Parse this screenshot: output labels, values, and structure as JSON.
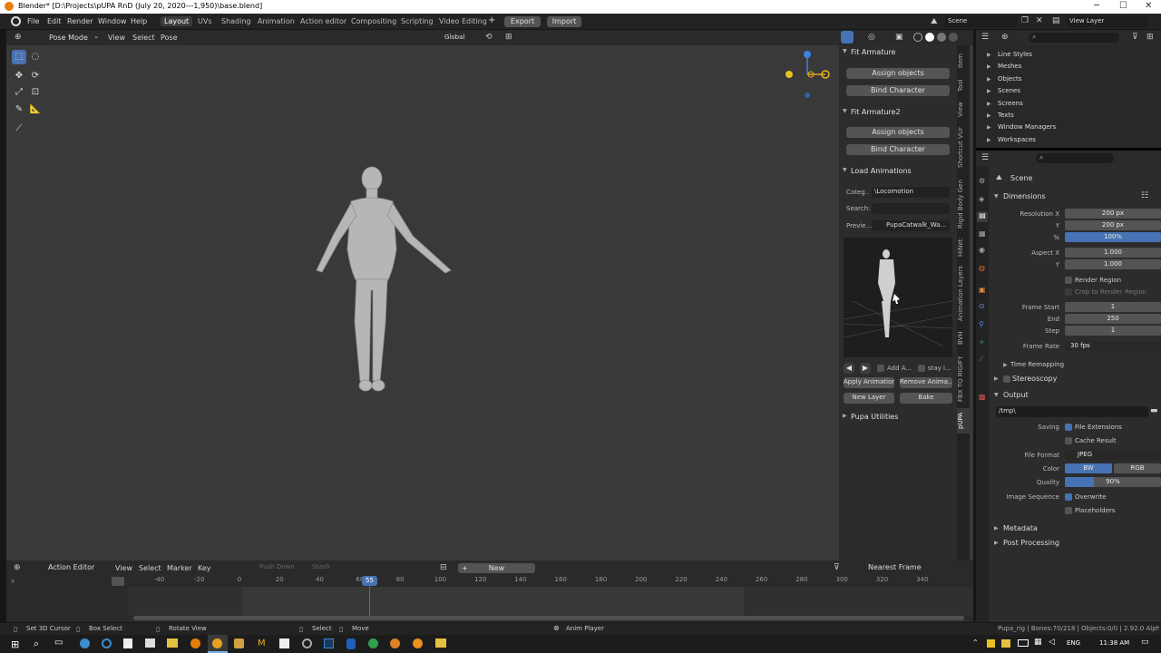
{
  "window": {
    "title": "Blender* [D:\\Projects\\pUPA RnD (July 20, 2020---1,950)\\base.blend]"
  },
  "menu": [
    "File",
    "Edit",
    "Render",
    "Window",
    "Help"
  ],
  "workspaces": [
    "Layout",
    "UVs",
    "Shading",
    "Animation",
    "Action editor",
    "Compositing",
    "Scripting",
    "Video Editing"
  ],
  "active_workspace": "Layout",
  "top_buttons": {
    "export": "Export",
    "import": "Import"
  },
  "scene_name": "Scene",
  "view_layer": "View Layer",
  "viewport_header": {
    "mode": "Pose Mode",
    "view": "View",
    "select": "Select",
    "pose": "Pose",
    "orientation": "Global"
  },
  "npanel": {
    "fit1": {
      "title": "Fit Armature",
      "assign": "Assign objects",
      "bind": "Bind Character"
    },
    "fit2": {
      "title": "Fit Armature2",
      "assign": "Assign objects",
      "bind": "Bind Character"
    },
    "load": {
      "title": "Load Animations",
      "category_label": "Categ..",
      "category_value": "\\Locomotion",
      "search_label": "Search:",
      "preview_label": "Previe...",
      "preview_value": "PupaCatwalk_Wa...",
      "add_label": "Add A...",
      "stay_label": "stay i...",
      "apply": "Apply Animation",
      "remove": "Remove Anima...",
      "new_layer": "New Layer",
      "bake": "Bake"
    },
    "utilities": "Pupa Utilities"
  },
  "sidebar_tabs": [
    "Item",
    "Tool",
    "View",
    "Shortcut VUr",
    "Rigid Body Gen",
    "HiNet",
    "Animation Layers",
    "BVH",
    "FBX TO RIGIFY",
    "pUPA"
  ],
  "outliner": {
    "items": [
      "Line Styles",
      "Meshes",
      "Objects",
      "Scenes",
      "Screens",
      "Texts",
      "Window Managers",
      "Workspaces"
    ]
  },
  "properties": {
    "scene": "Scene",
    "dimensions": "Dimensions",
    "resolution_x_label": "Resolution X",
    "resolution_x": "200 px",
    "y_label": "Y",
    "resolution_y": "200 px",
    "percent_label": "%",
    "percent": "100%",
    "aspect_x_label": "Aspect X",
    "aspect_x": "1.000",
    "aspect_y": "1.000",
    "render_region": "Render Region",
    "crop": "Crop to Render Region",
    "frame_start_label": "Frame Start",
    "frame_start": "1",
    "end_label": "End",
    "frame_end": "250",
    "step_label": "Step",
    "step": "1",
    "frame_rate_label": "Frame Rate",
    "frame_rate": "30 fps",
    "time_remapping": "Time Remapping",
    "stereoscopy": "Stereoscopy",
    "output": "Output",
    "output_path": "/tmp\\",
    "saving_label": "Saving",
    "file_extensions": "File Extensions",
    "cache_result": "Cache Result",
    "file_format_label": "File Format",
    "file_format": "JPEG",
    "color_label": "Color",
    "color_bw": "BW",
    "color_rgb": "RGB",
    "quality_label": "Quality",
    "quality": "90%",
    "quality_fraction": 0.3,
    "image_sequence_label": "Image Sequence",
    "overwrite": "Overwrite",
    "placeholders": "Placeholders",
    "metadata": "Metadata",
    "post_processing": "Post Processing"
  },
  "timeline": {
    "editor": "Action Editor",
    "menus": [
      "View",
      "Select",
      "Marker",
      "Key"
    ],
    "push_down": "Push Down",
    "stash": "Stash",
    "new": "New",
    "snap": "Nearest Frame",
    "current_frame": "55",
    "ticks": [
      "-40",
      "-20",
      "0",
      "20",
      "40",
      "60",
      "80",
      "100",
      "120",
      "140",
      "160",
      "180",
      "200",
      "220",
      "240",
      "260",
      "280",
      "300",
      "320",
      "340"
    ]
  },
  "status": {
    "cursor": "Set 3D Cursor",
    "box": "Box Select",
    "rotate": "Rotate View",
    "select": "Select",
    "move": "Move",
    "anim_player": "Anim Player",
    "info": "Pupa_rig | Bones:70/218 | Objects:0/0 | 2.92.0 Alpha"
  },
  "taskbar": {
    "lang": "ENG",
    "time": "11:38 AM"
  }
}
